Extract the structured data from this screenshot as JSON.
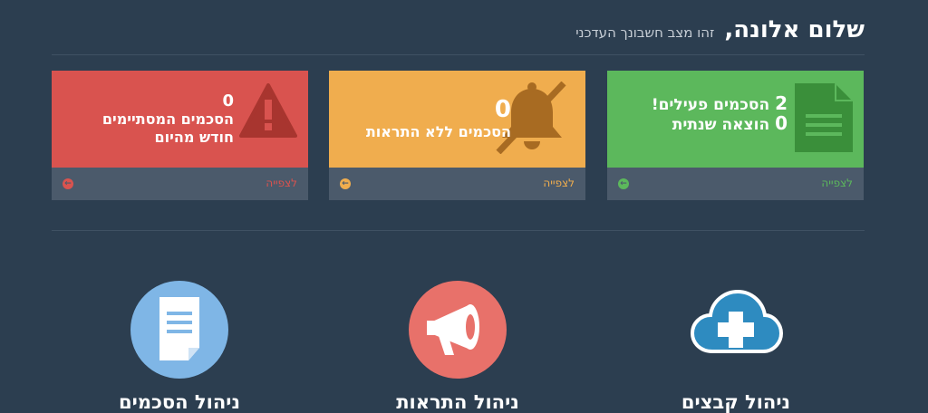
{
  "header": {
    "greeting": "שלום אלונה,",
    "subtitle": "זהו מצב חשבונך העדכני"
  },
  "cards": [
    {
      "color": "#5cb85c",
      "icon": "document-icon",
      "line1_value": "2",
      "line1_text": "הסכמים פעילים!",
      "line2_value": "0",
      "line2_text": "הוצאה שנתית",
      "link": "לצפייה",
      "arrow": "arrow-left-icon"
    },
    {
      "color": "#f0ad4e",
      "icon": "bell-slash-icon",
      "value": "0",
      "text": "הסכמים ללא התראות",
      "link": "לצפייה",
      "arrow": "arrow-left-icon"
    },
    {
      "color": "#d9534f",
      "icon": "warning-icon",
      "value": "0",
      "text_line1": "הסכמים המסתיימים",
      "text_line2": "חודש מהיום",
      "link": "לצפייה",
      "arrow": "arrow-left-icon"
    }
  ],
  "features": [
    {
      "label": "ניהול קבצים",
      "icon": "cloud-plus-icon",
      "color": "#2e8bc0"
    },
    {
      "label": "ניהול התראות",
      "icon": "megaphone-icon",
      "color": "#e8716a"
    },
    {
      "label": "ניהול הסכמים",
      "icon": "document-icon",
      "color": "#7fb6e6"
    }
  ]
}
